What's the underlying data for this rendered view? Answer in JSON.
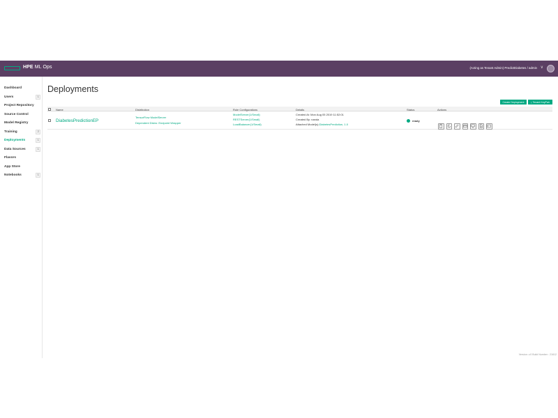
{
  "header": {
    "brand_bold": "HPE",
    "brand_light": "ML Ops",
    "acting_text": "(Acting as Tenant Admin) PredictDiabetes / admin",
    "brand_color": "#5b3f63",
    "accent_color": "#01a982"
  },
  "sidebar": {
    "items": [
      {
        "label": "Dashboard",
        "badge": ""
      },
      {
        "label": "Users",
        "badge": "1"
      },
      {
        "label": "Project Repository",
        "badge": ""
      },
      {
        "label": "Source Control",
        "badge": ""
      },
      {
        "label": "Model Registry",
        "badge": ""
      },
      {
        "label": "Training",
        "badge": "2"
      },
      {
        "label": "Deployments",
        "badge": "1",
        "active": true
      },
      {
        "label": "Data Sources",
        "badge": "1"
      },
      {
        "label": "Flavors",
        "badge": ""
      },
      {
        "label": "App Store",
        "badge": ""
      },
      {
        "label": "Notebooks",
        "badge": "1"
      }
    ]
  },
  "main": {
    "title": "Deployments",
    "create_button": "Create Deployment",
    "keypair_button": "⤓ Tenant KeyPair",
    "columns": {
      "name": "Name",
      "distribution": "Distribution",
      "role_configurations": "Role Configurations",
      "details": "Details",
      "status": "Status",
      "actions": "Actions"
    },
    "rows": [
      {
        "name": "DiabetesPredictionEP",
        "distribution": [
          "TensorFlow ModelServer",
          "Dependent Distro: Endpoint Wrapper"
        ],
        "roles": [
          "ModelServer(1/Small)",
          "RESTServer(1/Small)",
          "LoadBalancer(1/Small)"
        ],
        "details": {
          "created_at": "Created At: Mon Aug 05 2019 11:52:01",
          "created_by": "Created By: nanda",
          "attached_label": "Attached Model(s):",
          "attached_model": "DiabetesPrediction, 1.0"
        },
        "status": "ready",
        "actions": [
          "clipboard-icon",
          "refresh-icon",
          "edit-icon",
          "window-icon",
          "monitor-icon",
          "document-icon",
          "terminal-icon"
        ]
      }
    ]
  },
  "footer": {
    "version": "Version: v.0 Build Number : 21612"
  }
}
